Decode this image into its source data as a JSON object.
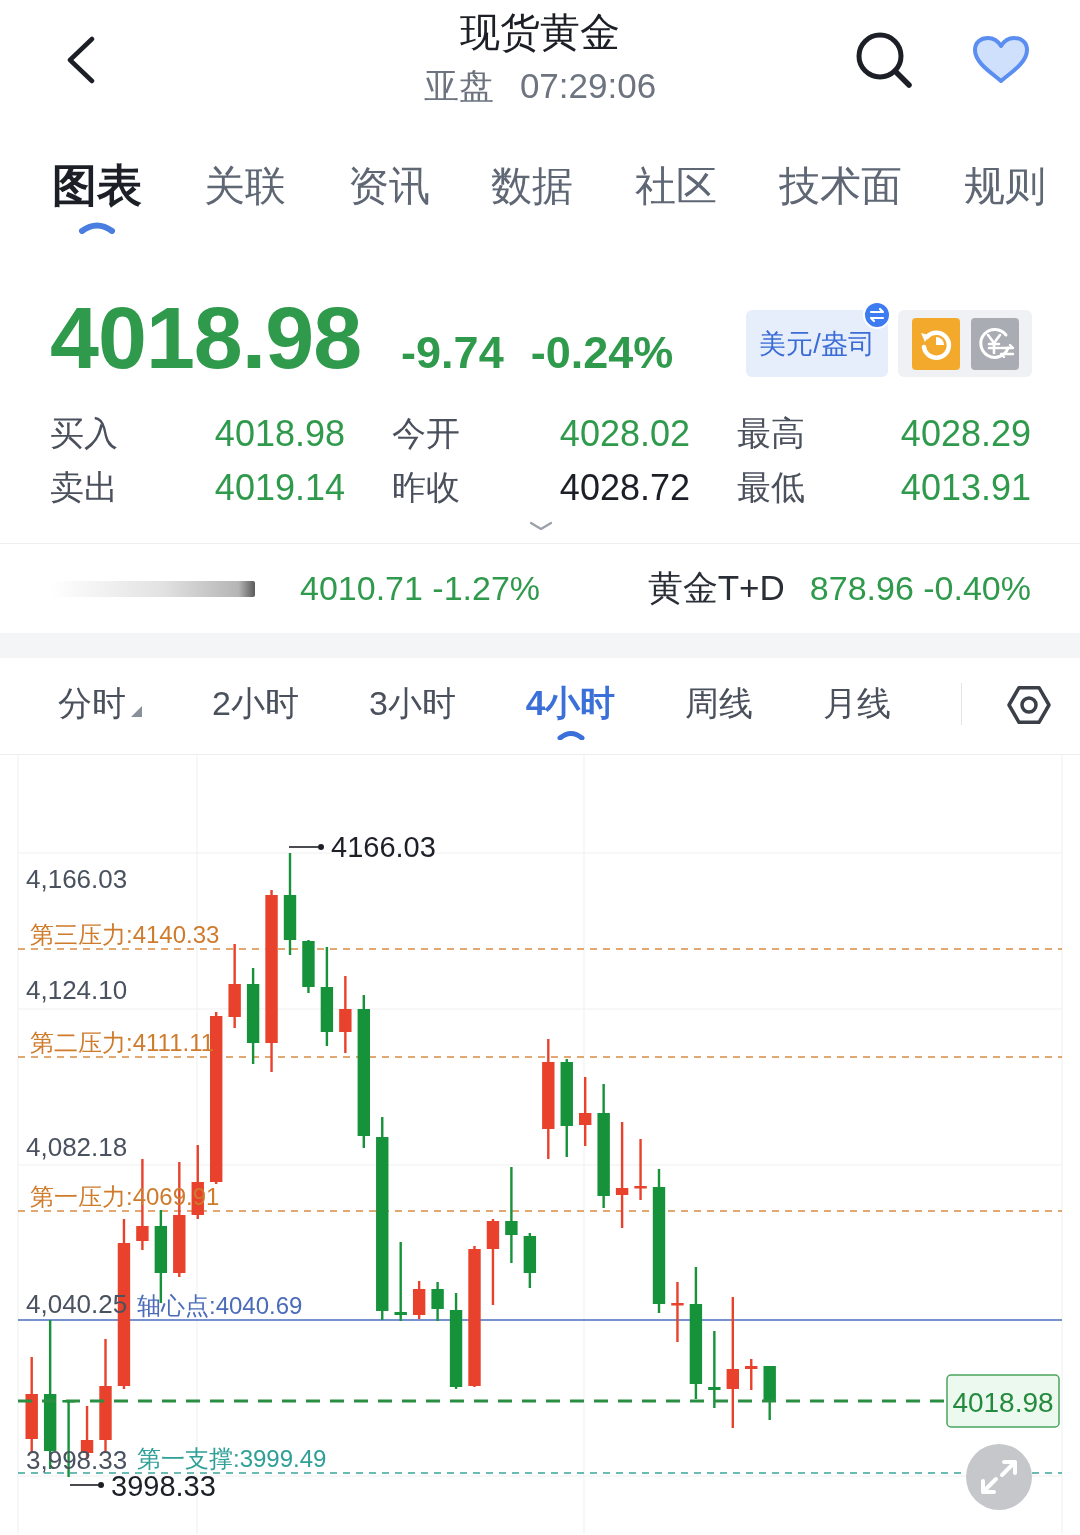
{
  "header": {
    "title": "现货黄金",
    "session": "亚盘",
    "time": "07:29:06",
    "favorited": true
  },
  "tabs": [
    {
      "label": "图表",
      "selected": true
    },
    {
      "label": "关联",
      "selected": false
    },
    {
      "label": "资讯",
      "selected": false
    },
    {
      "label": "数据",
      "selected": false
    },
    {
      "label": "社区",
      "selected": false
    },
    {
      "label": "技术面",
      "selected": false
    },
    {
      "label": "规则",
      "selected": false
    }
  ],
  "quote": {
    "price": "4018.98",
    "change": "-9.74",
    "change_percent": "-0.24%",
    "unit": "美元/盎司"
  },
  "stats": [
    {
      "label": "买入",
      "value": "4018.98",
      "color": "#2f9a4c"
    },
    {
      "label": "今开",
      "value": "4028.02",
      "color": "#2f9a4c"
    },
    {
      "label": "最高",
      "value": "4028.29",
      "color": "#2f9a4c"
    },
    {
      "label": "卖出",
      "value": "4019.14",
      "color": "#2f9a4c"
    },
    {
      "label": "昨收",
      "value": "4028.72",
      "color": "#1c1f26"
    },
    {
      "label": "最低",
      "value": "4013.91",
      "color": "#2f9a4c"
    }
  ],
  "related": [
    {
      "kind": "redacted",
      "quote": "4010.71 -1.27%"
    },
    {
      "kind": "named",
      "name": "黄金T+D",
      "quote": "878.96 -0.40%"
    }
  ],
  "periods": [
    {
      "label": "分时",
      "kind": "dropdown",
      "selected": false
    },
    {
      "label": "2小时",
      "kind": "plain",
      "selected": false
    },
    {
      "label": "3小时",
      "kind": "plain",
      "selected": false
    },
    {
      "label": "4小时",
      "kind": "plain",
      "selected": true
    },
    {
      "label": "周线",
      "kind": "plain",
      "selected": false
    },
    {
      "label": "月线",
      "kind": "plain",
      "selected": false
    }
  ],
  "chart": {
    "y_axis": [
      "4,166.03",
      "4,124.10",
      "4,082.18",
      "4,040.25",
      "3,998.33"
    ],
    "levels": [
      {
        "kind": "resistance",
        "label": "第三压力:4140.33"
      },
      {
        "kind": "resistance",
        "label": "第二压力:4111.11"
      },
      {
        "kind": "resistance",
        "label": "第一压力:4069.91"
      },
      {
        "kind": "pivot",
        "label": "轴心点:4040.69"
      },
      {
        "kind": "support",
        "label": "第一支撑:3999.49"
      }
    ],
    "high_label": "4166.03",
    "low_label": "3998.33",
    "last_price": "4018.98"
  }
}
